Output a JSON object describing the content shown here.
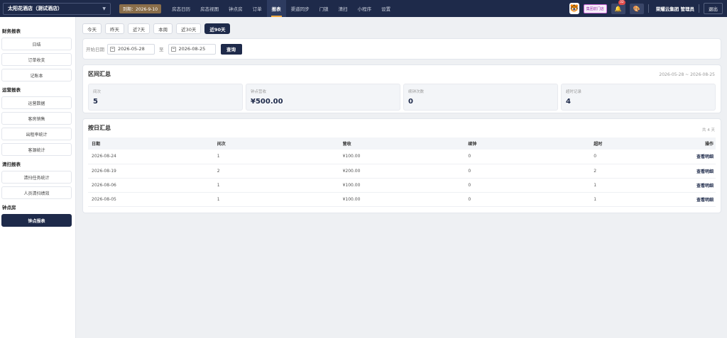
{
  "topbar": {
    "hotel": "太阳花酒店（测试酒店）",
    "expire": "到期：2026-9-10",
    "nav": [
      "房态日历",
      "房态视图",
      "钟点房",
      "订单",
      "报表",
      "渠道同步",
      "门锁",
      "清扫",
      "小程序",
      "设置"
    ],
    "active_nav": "报表",
    "group_tag": "集团前门店",
    "notif_count": "32",
    "user": "荣耀云集团 管理员",
    "logout": "退出"
  },
  "sidebar": {
    "groups": [
      {
        "title": "财务报表",
        "items": [
          "日结",
          "订单收支",
          "记账本"
        ]
      },
      {
        "title": "运营报表",
        "items": [
          "运营数据",
          "客房销售",
          "出租率统计",
          "客源统计"
        ]
      },
      {
        "title": "清扫报表",
        "items": [
          "清扫任务统计",
          "人员清扫绩效"
        ]
      },
      {
        "title": "钟点房",
        "items": [
          "钟点报表"
        ]
      }
    ],
    "active_item": "钟点报表"
  },
  "period_tabs": [
    "今天",
    "昨天",
    "近7天",
    "本周",
    "近30天",
    "近90天"
  ],
  "active_period": "近90天",
  "date_filter": {
    "start_label": "开始日期",
    "start": "2026-05-28",
    "to_label": "至",
    "end": "2026-08-25",
    "query": "查询"
  },
  "summary": {
    "title": "区间汇总",
    "range": "2026-05-28 ~ 2026-08-25",
    "stats": [
      {
        "label": "间次",
        "value": "5"
      },
      {
        "label": "钟点营收",
        "value": "¥500.00"
      },
      {
        "label": "续钟次数",
        "value": "0"
      },
      {
        "label": "超时记录",
        "value": "4"
      }
    ]
  },
  "daily": {
    "title": "按日汇总",
    "total": "共 4 天",
    "columns": [
      "日期",
      "间次",
      "营收",
      "续钟",
      "超时",
      "操作"
    ],
    "rows": [
      [
        "2026-08-24",
        "1",
        "¥100.00",
        "0",
        "0",
        "查看明细"
      ],
      [
        "2026-08-19",
        "2",
        "¥200.00",
        "0",
        "2",
        "查看明细"
      ],
      [
        "2026-08-06",
        "1",
        "¥100.00",
        "0",
        "1",
        "查看明细"
      ],
      [
        "2026-08-05",
        "1",
        "¥100.00",
        "0",
        "1",
        "查看明细"
      ]
    ]
  },
  "icons": {
    "mascot": "tiger-avatar-icon",
    "bell": "bell-icon",
    "palette": "palette-icon",
    "calendar": "calendar-icon",
    "caret": "caret-down-icon"
  }
}
